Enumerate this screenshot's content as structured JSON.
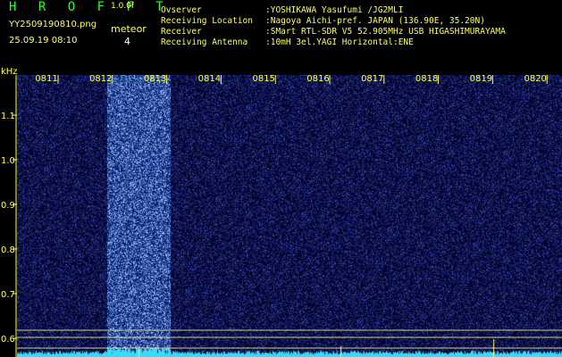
{
  "header": {
    "app_title": "H R O F F T",
    "version": "1.0.0f",
    "filename": "YY2509190810.png",
    "datetime": "25.09.19 08:10",
    "mode_label": "meteor",
    "mode_count": "4"
  },
  "info": [
    {
      "label": "Ovserver",
      "value": ":YOSHIKAWA Yasufumi /JG2MLI"
    },
    {
      "label": "Receiving Location",
      "value": ":Nagoya Aichi-pref. JAPAN (136.90E, 35.20N)"
    },
    {
      "label": "Receiver",
      "value": ":SMart RTL-SDR V5 52.905MHz USB HIGASHIMURAYAMA"
    },
    {
      "label": "Receiving Antenna",
      "value": ":10mH 3el.YAGI Horizontal:ENE"
    }
  ],
  "chart_data": {
    "type": "heatmap",
    "ylabel": "kHz",
    "y_ticks": [
      "1.1",
      "1.0",
      "0.9",
      "0.8",
      "0.7",
      "0.6"
    ],
    "x_ticks": [
      "0811",
      "0812",
      "0813",
      "0814",
      "0815",
      "0816",
      "0817",
      "0818",
      "0819",
      "0820"
    ],
    "colors": {
      "background": "#000000",
      "heat_low": "#0a0a6e",
      "heat_high": "#8cc8ff",
      "tick": "#ffff55",
      "level_line": "#ffff88",
      "level_fill": "#33ddff"
    }
  }
}
